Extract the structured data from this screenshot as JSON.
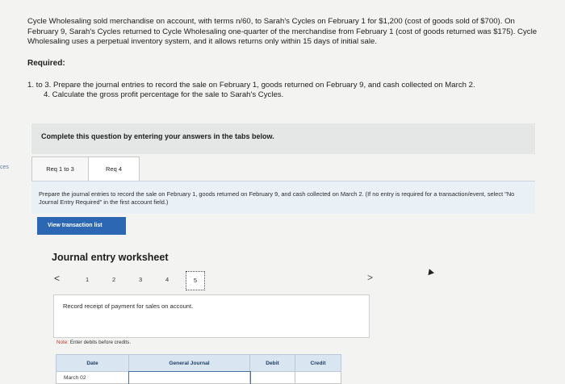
{
  "margin_label": "ces",
  "problem": {
    "text": "Cycle Wholesaling sold merchandise on account, with terms n/60, to Sarah's Cycles on February 1 for $1,200 (cost of goods sold of $700). On February 9, Sarah's Cycles returned to Cycle Wholesaling one-quarter of the merchandise from February 1 (cost of goods returned was $175). Cycle Wholesaling uses a perpetual inventory system, and it allows returns only within 15 days of initial sale."
  },
  "required": {
    "title": "Required:",
    "items": [
      "1. to 3. Prepare the journal entries to record the sale on February 1, goods returned on February 9, and cash collected on March 2.",
      "4. Calculate the gross profit percentage for the sale to Sarah's Cycles."
    ]
  },
  "complete_prompt": "Complete this question by entering your answers in the tabs below.",
  "tabs": [
    {
      "label": "Req 1 to 3",
      "active": true
    },
    {
      "label": "Req 4",
      "active": false
    }
  ],
  "instructions": "Prepare the journal entries to record the sale on February 1, goods returned on February 9, and cash collected on March 2. (If no entry is required for a transaction/event, select \"No Journal Entry Required\" in the first account field.)",
  "view_button": "View transaction list",
  "worksheet": {
    "title": "Journal entry worksheet",
    "prev": "<",
    "next": ">",
    "pages": [
      "1",
      "2",
      "3",
      "4",
      "5"
    ],
    "active_page": "5",
    "record_text": "Record receipt of payment for sales on account.",
    "note_prefix": "Note:",
    "note_text": "Enter debits before credits."
  },
  "table": {
    "headers": [
      "Date",
      "General Journal",
      "Debit",
      "Credit"
    ],
    "rows": [
      [
        "March 02",
        "",
        "",
        ""
      ]
    ]
  }
}
